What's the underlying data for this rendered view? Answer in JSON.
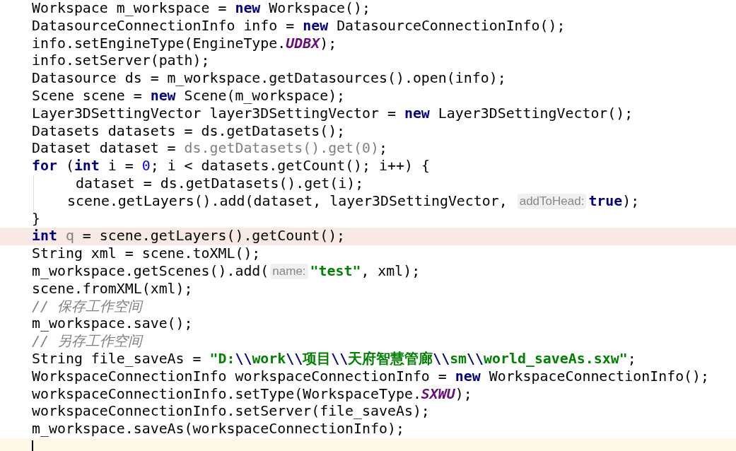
{
  "editor": {
    "lines": [
      {
        "tokens": [
          {
            "text": "Workspace m_workspace = ",
            "kind": "plain"
          },
          {
            "text": "new",
            "kind": "keyword"
          },
          {
            "text": " Workspace();",
            "kind": "plain"
          }
        ]
      },
      {
        "tokens": [
          {
            "text": "DatasourceConnectionInfo info = ",
            "kind": "plain"
          },
          {
            "text": "new",
            "kind": "keyword"
          },
          {
            "text": " DatasourceConnectionInfo();",
            "kind": "plain"
          }
        ]
      },
      {
        "tokens": [
          {
            "text": "info.setEngineType(EngineType.",
            "kind": "plain"
          },
          {
            "text": "UDBX",
            "kind": "constant"
          },
          {
            "text": ");",
            "kind": "plain"
          }
        ]
      },
      {
        "tokens": [
          {
            "text": "info.setServer(path);",
            "kind": "plain"
          }
        ]
      },
      {
        "tokens": [
          {
            "text": "Datasource ds = m_workspace.getDatasources().open(info);",
            "kind": "plain"
          }
        ]
      },
      {
        "tokens": [
          {
            "text": "Scene scene = ",
            "kind": "plain"
          },
          {
            "text": "new",
            "kind": "keyword"
          },
          {
            "text": " Scene(m_workspace);",
            "kind": "plain"
          }
        ]
      },
      {
        "tokens": [
          {
            "text": "Layer3DSettingVector layer3DSettingVector = ",
            "kind": "plain"
          },
          {
            "text": "new",
            "kind": "keyword"
          },
          {
            "text": " Layer3DSettingVector();",
            "kind": "plain"
          }
        ]
      },
      {
        "tokens": [
          {
            "text": "Datasets datasets = ds.getDatasets();",
            "kind": "plain"
          }
        ]
      },
      {
        "tokens": [
          {
            "text": "Dataset dataset = ",
            "kind": "plain"
          },
          {
            "text": "ds.getDatasets().get(0)",
            "kind": "unused"
          },
          {
            "text": ";",
            "kind": "plain"
          }
        ]
      },
      {
        "tokens": [
          {
            "text": "for",
            "kind": "keyword"
          },
          {
            "text": " (",
            "kind": "plain"
          },
          {
            "text": "int",
            "kind": "keyword"
          },
          {
            "text": " i = ",
            "kind": "plain"
          },
          {
            "text": "0",
            "kind": "number"
          },
          {
            "text": "; i < datasets.getCount(); i++) {",
            "kind": "plain"
          }
        ],
        "children": [
          {
            "tokens": [
              {
                "text": " dataset = ds.getDatasets().get(i);",
                "kind": "plain"
              }
            ]
          },
          {
            "tokens": [
              {
                "text": "scene.getLayers().add(dataset, layer3DSettingVector, ",
                "kind": "plain"
              },
              {
                "text": "addToHead:",
                "kind": "hint"
              },
              {
                "text": "true",
                "kind": "keyword"
              },
              {
                "text": ");",
                "kind": "plain"
              }
            ]
          }
        ]
      },
      {
        "tokens": [
          {
            "text": "}",
            "kind": "plain"
          }
        ]
      },
      {
        "tokens": [
          {
            "text": "int ",
            "kind": "keyword"
          },
          {
            "text": "q",
            "kind": "unused"
          },
          {
            "text": " = scene.getLayers().getCount();",
            "kind": "plain"
          }
        ],
        "highlighted": true
      },
      {
        "tokens": [
          {
            "text": "String xml = scene.toXML();",
            "kind": "plain"
          }
        ]
      },
      {
        "tokens": [
          {
            "text": "m_workspace.getScenes().add(",
            "kind": "plain"
          },
          {
            "text": "name:",
            "kind": "hint"
          },
          {
            "text": "\"test\"",
            "kind": "string"
          },
          {
            "text": ", xml);",
            "kind": "plain"
          }
        ]
      },
      {
        "tokens": [
          {
            "text": "scene.fromXML(xml);",
            "kind": "plain"
          }
        ]
      },
      {
        "tokens": [
          {
            "text": "// 保存工作空间",
            "kind": "comment"
          }
        ]
      },
      {
        "tokens": [
          {
            "text": "m_workspace.save();",
            "kind": "plain"
          }
        ]
      },
      {
        "tokens": [
          {
            "text": "// 另存工作空间",
            "kind": "comment"
          }
        ]
      },
      {
        "tokens": [
          {
            "text": "String file_saveAs = ",
            "kind": "plain"
          },
          {
            "text": "\"D:",
            "kind": "string"
          },
          {
            "text": "\\\\",
            "kind": "escape"
          },
          {
            "text": "work",
            "kind": "string"
          },
          {
            "text": "\\\\",
            "kind": "escape"
          },
          {
            "text": "项目",
            "kind": "string"
          },
          {
            "text": "\\\\",
            "kind": "escape"
          },
          {
            "text": "天府智慧管廊",
            "kind": "string"
          },
          {
            "text": "\\\\",
            "kind": "escape"
          },
          {
            "text": "sm",
            "kind": "string"
          },
          {
            "text": "\\\\",
            "kind": "escape"
          },
          {
            "text": "world_saveAs.sxw\"",
            "kind": "string"
          },
          {
            "text": ";",
            "kind": "plain"
          }
        ]
      },
      {
        "tokens": [
          {
            "text": "WorkspaceConnectionInfo workspaceConnectionInfo = ",
            "kind": "plain"
          },
          {
            "text": "new",
            "kind": "keyword"
          },
          {
            "text": " WorkspaceConnectionInfo();",
            "kind": "plain"
          }
        ]
      },
      {
        "tokens": [
          {
            "text": "workspaceConnectionInfo.setType(WorkspaceType.",
            "kind": "plain"
          },
          {
            "text": "SXWU",
            "kind": "constant"
          },
          {
            "text": ");",
            "kind": "plain"
          }
        ]
      },
      {
        "tokens": [
          {
            "text": "workspaceConnectionInfo.setServer(file_saveAs);",
            "kind": "plain"
          }
        ]
      },
      {
        "tokens": [
          {
            "text": "m_workspace.saveAs(workspaceConnectionInfo);",
            "kind": "plain"
          }
        ]
      },
      {
        "caret": true
      }
    ]
  }
}
